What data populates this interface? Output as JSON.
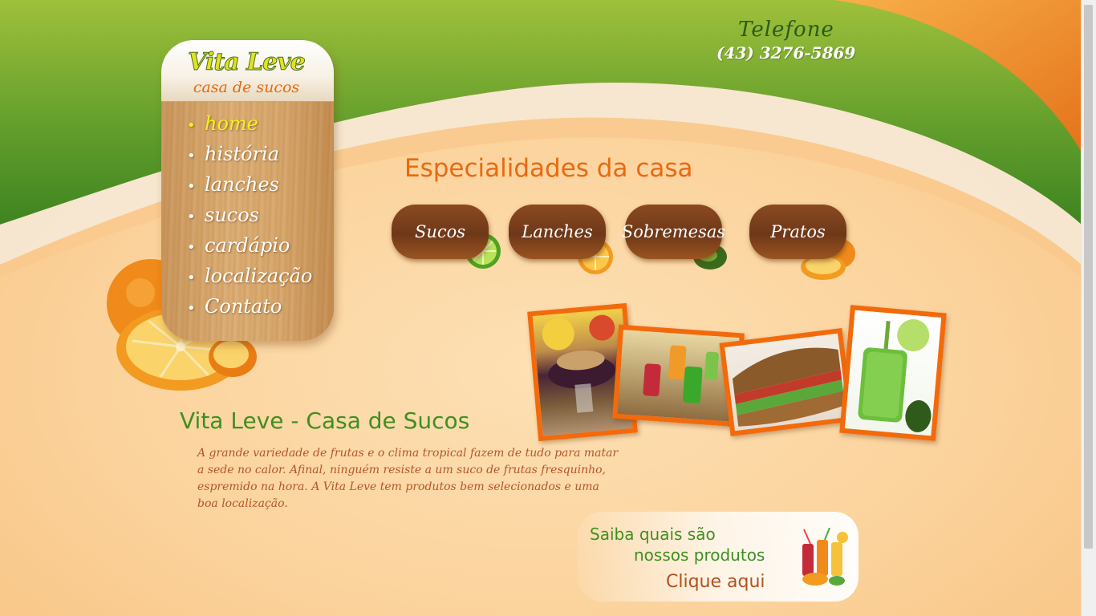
{
  "header": {
    "phone_label": "Telefone",
    "phone_number": "(43) 3276-5869"
  },
  "logo": {
    "title": "Vita Leve",
    "subtitle": "casa de sucos"
  },
  "menu": {
    "items": [
      {
        "label": "home",
        "active": true
      },
      {
        "label": "história",
        "active": false
      },
      {
        "label": "lanches",
        "active": false
      },
      {
        "label": "sucos",
        "active": false
      },
      {
        "label": "cardápio",
        "active": false
      },
      {
        "label": "localização",
        "active": false
      },
      {
        "label": "Contato",
        "active": false
      }
    ]
  },
  "specialties": {
    "title": "Especialidades da casa",
    "buttons": [
      {
        "label": "Sucos",
        "fruit_icon": "lime-icon"
      },
      {
        "label": "Lanches",
        "fruit_icon": "orange-slice-icon"
      },
      {
        "label": "Sobremesas",
        "fruit_icon": "avocado-icon"
      },
      {
        "label": "Pratos",
        "fruit_icon": "oranges-icon"
      }
    ]
  },
  "photos": [
    {
      "name": "acai-photo"
    },
    {
      "name": "juices-photo"
    },
    {
      "name": "sandwich-photo"
    },
    {
      "name": "green-juice-photo"
    }
  ],
  "intro": {
    "title": "Vita Leve - Casa de Sucos",
    "text": "A grande variedade de frutas e o clima tropical fazem de tudo para matar a sede no calor. Afinal, ninguém resiste a um suco de frutas fresquinho, espremido na hora. A Vita Leve tem produtos bem selecionados e uma boa localização."
  },
  "promo": {
    "line1": "Saiba quais são",
    "line2": "nossos produtos",
    "link": "Clique aqui"
  },
  "colors": {
    "green": "#5f9c2b",
    "orange": "#f26a0c",
    "peach": "#fbd29b",
    "brown_button": "#7a3f1c",
    "menu_active": "#f4f11d"
  }
}
